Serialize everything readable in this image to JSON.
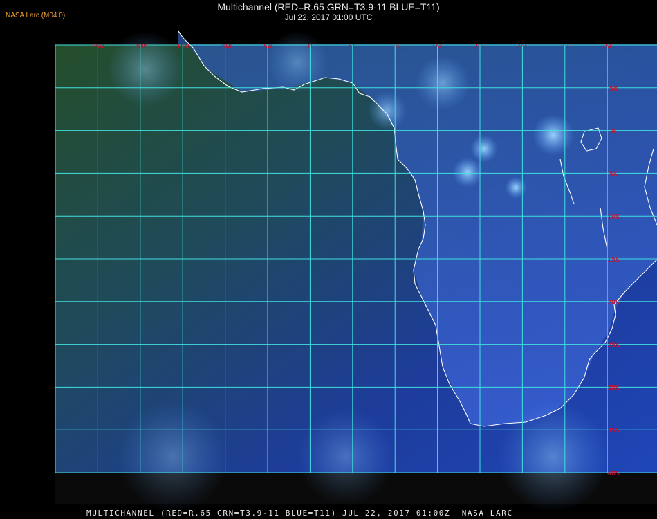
{
  "header": {
    "credit": "NASA Larc (M04.0)",
    "title": "Multichannel (RED=R.65 GRN=T3.9-11 BLUE=T11)",
    "datetime": "Jul 22, 2017 01:00 UTC"
  },
  "footer": {
    "caption": "MULTICHANNEL (RED=R.65 GRN=T3.9-11 BLUE=T11) JUL 22, 2017 01:00Z  NASA LARC"
  },
  "map": {
    "lon_labels": [
      "25W",
      "20W",
      "15W",
      "10W",
      "5W",
      "0",
      "5E",
      "10E",
      "15E",
      "20E",
      "25E",
      "30E",
      "35E"
    ],
    "lat_labels": [
      "5N",
      "0",
      "5S",
      "10S",
      "15S",
      "20S",
      "25S",
      "30S",
      "35S",
      "40S"
    ],
    "colors": {
      "grid": "#40e0e0",
      "label": "#c8102e",
      "coast": "#ffffff",
      "ocean": "#1e3fa8",
      "land_north": "#1f4a22"
    }
  }
}
